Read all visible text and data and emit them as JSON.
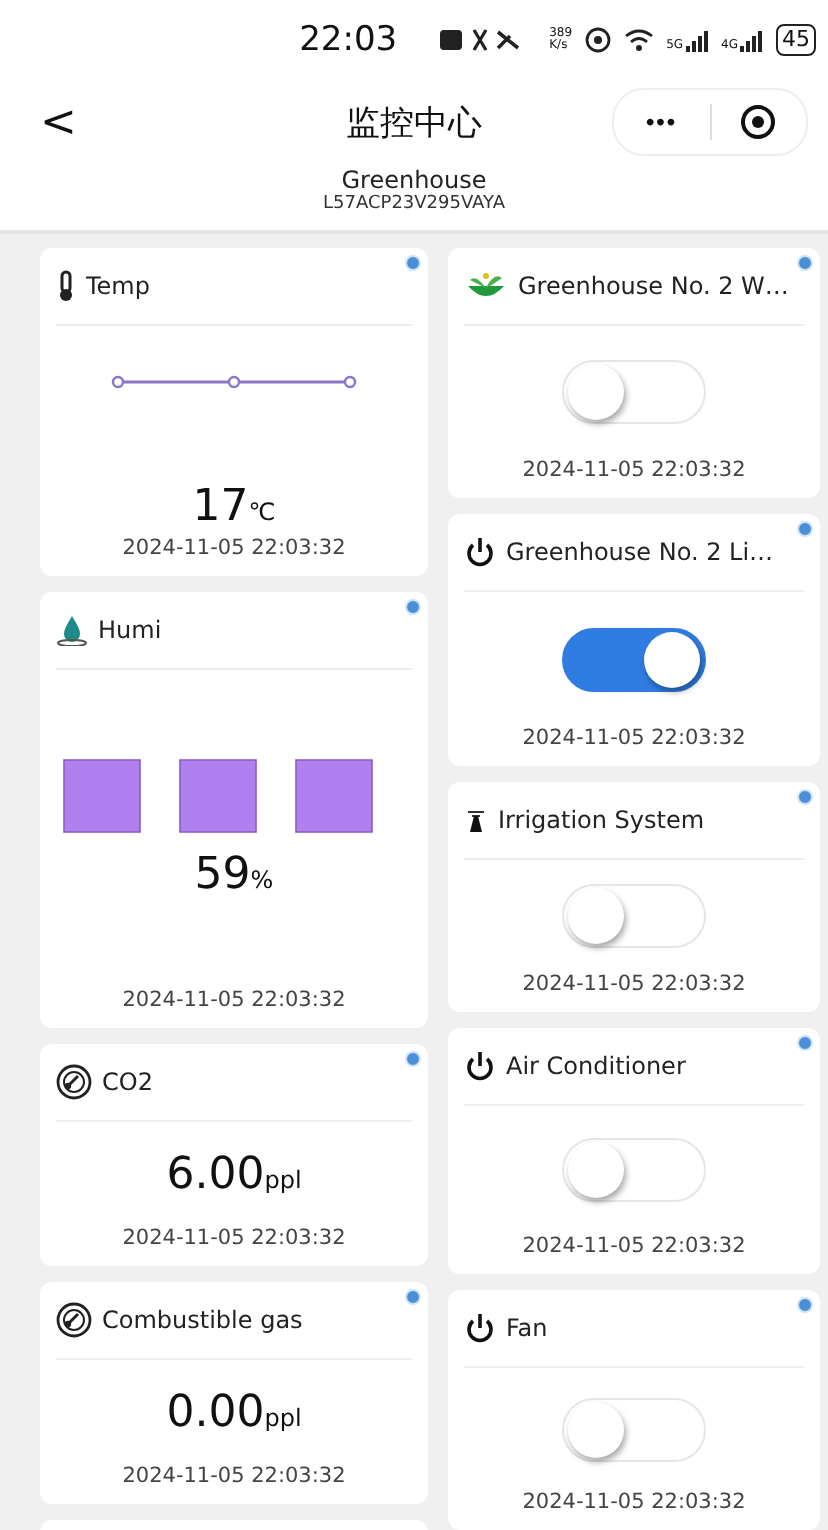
{
  "status_bar": {
    "time": "22:03",
    "net_speed": "389",
    "net_unit": "K/s",
    "sim1": "5G",
    "sim2": "4G",
    "battery": "45"
  },
  "nav": {
    "back": "<",
    "title": "监控中心",
    "more": "•••"
  },
  "device": {
    "name": "Greenhouse",
    "id": "L57ACP23V295VAYA"
  },
  "left_cards": [
    {
      "kind": "line",
      "title": "Temp",
      "value": "17",
      "unit": "℃",
      "time": "2024-11-05 22:03:32"
    },
    {
      "kind": "bars",
      "title": "Humi",
      "value": "59",
      "unit": "%",
      "time": "2024-11-05 22:03:32"
    },
    {
      "kind": "value",
      "title": "CO2",
      "value": "6.00",
      "unit": "ppl",
      "time": "2024-11-05 22:03:32"
    },
    {
      "kind": "value",
      "title": "Combustible gas",
      "value": "0.00",
      "unit": "ppl",
      "time": "2024-11-05 22:03:32"
    }
  ],
  "right_cards": [
    {
      "title": "Greenhouse No. 2 W…",
      "on": false,
      "time": "2024-11-05 22:03:32"
    },
    {
      "title": "Greenhouse No. 2 Li…",
      "on": true,
      "time": "2024-11-05 22:03:32"
    },
    {
      "title": "Irrigation System",
      "on": false,
      "time": "2024-11-05 22:03:32"
    },
    {
      "title": "Air Conditioner",
      "on": false,
      "time": "2024-11-05 22:03:32"
    },
    {
      "title": "Fan",
      "on": false,
      "time": "2024-11-05 22:03:32"
    }
  ]
}
